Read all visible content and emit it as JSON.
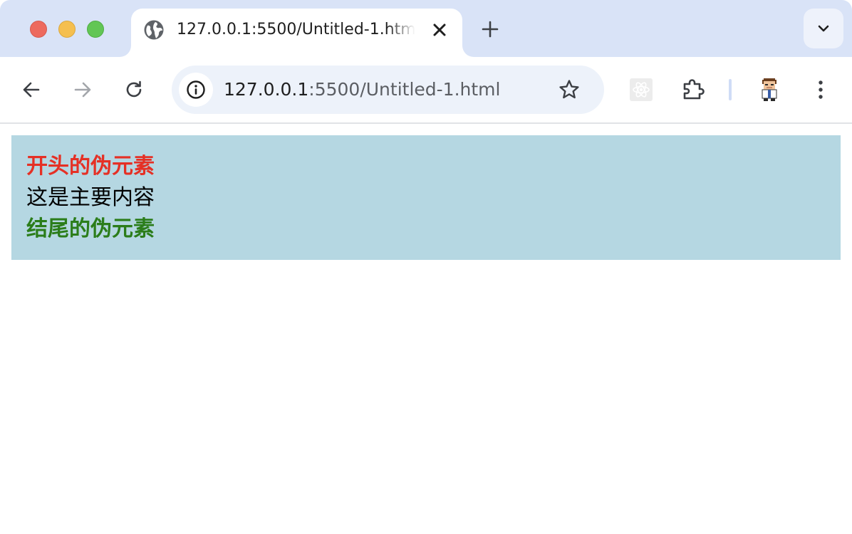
{
  "window": {
    "traffic_lights": {
      "close": "#ed6a5e",
      "minimize": "#f5bf4f",
      "maximize": "#62c655"
    }
  },
  "tab": {
    "title": "127.0.0.1:5500/Untitled-1.html",
    "favicon": "globe-icon",
    "close_icon": "close-icon"
  },
  "toolbar": {
    "back_icon": "back-arrow-icon",
    "forward_icon": "forward-arrow-icon",
    "reload_icon": "reload-icon",
    "omnibox": {
      "site_info_icon": "info-icon",
      "url_host": "127.0.0.1",
      "url_rest": ":5500/Untitled-1.html",
      "bookmark_icon": "star-icon"
    },
    "extensions": [
      "react-devtools-icon",
      "extensions-puzzle-icon"
    ],
    "profile_icon": "avatar-icon",
    "menu_icon": "more-vertical-icon"
  },
  "page": {
    "background": "#b5d7e2",
    "before_text": "开头的伪元素",
    "before_color": "#e53025",
    "main_text": "这是主要内容",
    "after_text": "结尾的伪元素",
    "after_color": "#2b7d1a"
  }
}
